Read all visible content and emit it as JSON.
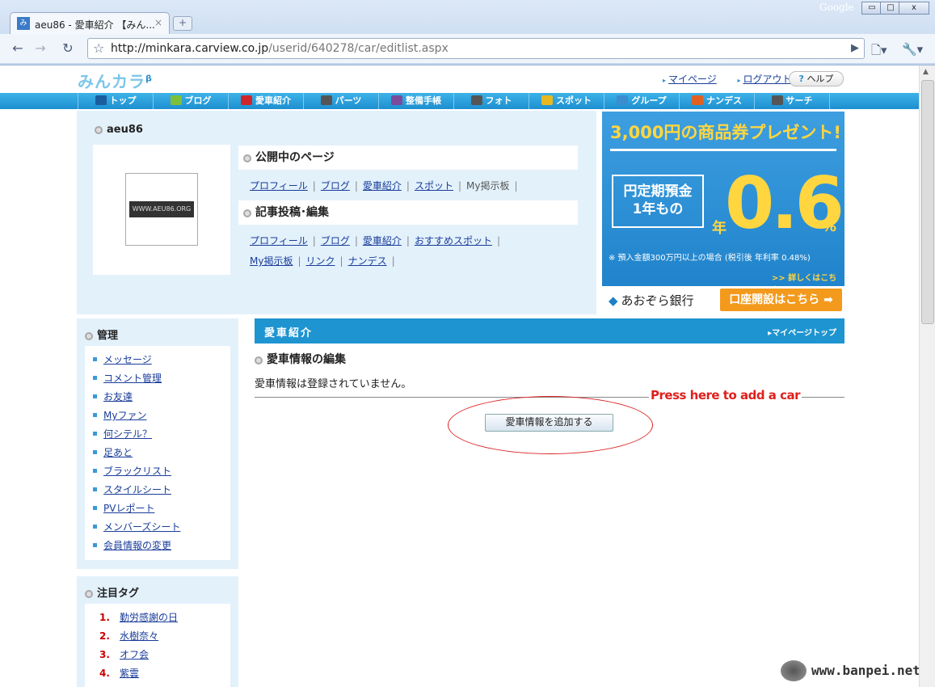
{
  "browser": {
    "tab_title": "aeu86 - 愛車紹介 【みん...",
    "tab_close": "×",
    "new_tab": "+",
    "brand": "Google",
    "win_minimize": "▭",
    "win_maximize": "□",
    "win_close": "x",
    "url_host": "http://minkara.carview.co.jp",
    "url_path": "/userid/640278/car/editlist.aspx"
  },
  "site": {
    "logo": "みんカラ",
    "logo_sup": "β",
    "toplinks": {
      "mypage": "マイページ",
      "logout": "ログアウト",
      "help": "ヘルプ"
    },
    "nav": [
      "トップ",
      "ブログ",
      "愛車紹介",
      "パーツ",
      "整備手帳",
      "フォト",
      "スポット",
      "グループ",
      "ナンデス",
      "サーチ"
    ],
    "nav_colors": [
      "#1b5e9e",
      "#7cbf3a",
      "#d0262b",
      "#555555",
      "#7a4b9a",
      "#555555",
      "#e8b820",
      "#3a8ed0",
      "#e06020",
      "#555555"
    ]
  },
  "user": {
    "name": "aeu86",
    "avatar_text": "WWW.AEU86.ORG",
    "public_pages": {
      "heading": "公開中のページ",
      "links": [
        "プロフィール",
        "ブログ",
        "愛車紹介",
        "スポット"
      ],
      "plain": "My掲示板"
    },
    "edit": {
      "heading": "記事投稿･編集",
      "links_row1": [
        "プロフィール",
        "ブログ",
        "愛車紹介",
        "おすすめスポット"
      ],
      "links_row2": [
        "My掲示板",
        "リンク",
        "ナンデス"
      ]
    }
  },
  "ad": {
    "headline": "3,000円の商品券プレゼント!",
    "box": [
      "円定期預金",
      "1年もの"
    ],
    "year": "年",
    "rate": "0.6",
    "percent": "%",
    "note": "※ 預入金額300万円以上の場合 (税引後 年利率 0.48%)",
    "more": ">> 詳しくはこちら",
    "bank": "あおぞら銀行",
    "cta": "口座開設はこちら"
  },
  "sidebar": {
    "heading": "管理",
    "items": [
      "メッセージ",
      "コメント管理",
      "お友達",
      "Myファン",
      "何シテル？",
      "足あと",
      "ブラックリスト",
      "スタイルシート",
      "PVレポート",
      "メンバーズシート",
      "会員情報の変更"
    ]
  },
  "tags": {
    "heading": "注目タグ",
    "items": [
      {
        "n": "1.",
        "label": "勤労感謝の日"
      },
      {
        "n": "2.",
        "label": "水樹奈々"
      },
      {
        "n": "3.",
        "label": "オフ会"
      },
      {
        "n": "4.",
        "label": "紫雲"
      }
    ]
  },
  "main": {
    "title": "愛車紹介",
    "mypage_top": "▸マイページトップ",
    "subheading": "愛車情報の編集",
    "empty_msg": "愛車情報は登録されていません。",
    "add_button": "愛車情報を追加する",
    "annotation": "Press here to add a car"
  },
  "watermark": "www.banpei.net"
}
